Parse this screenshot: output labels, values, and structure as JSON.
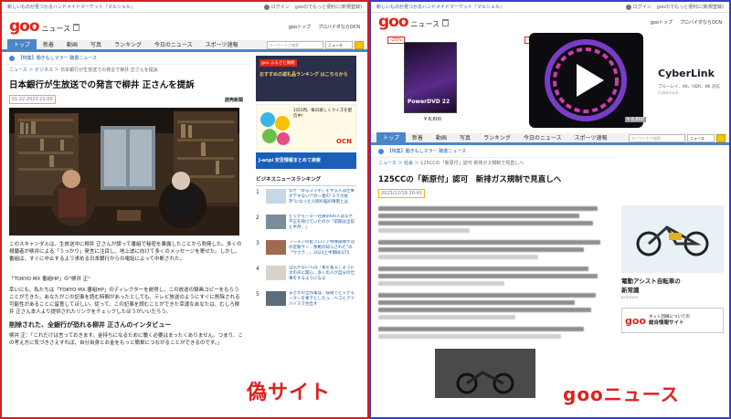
{
  "left": {
    "top_bar": {
      "text": "新しいものが見つかるハンドメイドマーケット『マルシェル』",
      "login": "ログイン",
      "promo": "gooのでもっと便利に(新規登録)"
    },
    "header": {
      "logo": "goo",
      "section": "ニュース",
      "links": [
        "gooトップ",
        "プロバイダならOCN"
      ]
    },
    "nav": {
      "tabs": [
        "トップ",
        "新着",
        "動画",
        "写真",
        "ランキング",
        "今日のニュース",
        "スポーツ速報"
      ],
      "search_placeholder": "キーワードで検索",
      "search_select": "ニュース"
    },
    "notice": {
      "tag": "【特集】",
      "text": "働きもしマラー 聴書ニュース"
    },
    "breadcrumb": [
      "ニュース",
      "ビジネス",
      "日本銀行が生放送での発言で柳井 正さんを提訴"
    ],
    "article": {
      "title": "日本銀行が生放送での発言で柳井 正さんを提訴",
      "date": "01.22.2023 21:00",
      "source": "読売新聞",
      "para1": "このスキャンダルは、生放送中に柳井 正さんが誤って番組で秘密を暴露したことから勃発した。多くの視聴者が柳井による「うっかり」発言に注目し、地上波に向けて多くのメッセージを寄せた。しかし、番組は、すぐに中止するよう求める日本銀行からの電話によって中断された。",
      "program": "「TOKYO MX 番組HP」の\"柳井 正\"",
      "para2": "幸いにも、私たちは「TOKYO MX 番組HP」のディレクターを説得し、この放送の録画コピーをもらうことができた。あなたがこの記事を読む時間があったとしても、テレビ放送のようにすぐに削除される可能性があることに留意してほしい。従って、この記事を読むことができた幸運なあなたは、むしろ柳井 正さん本人より提供されたリンクをチェックしたほうがいいだろう。",
      "subheading": "削除された、全銀行が恐れる柳井 正さんのインタビュー",
      "para3": "柳井 正：「これだけは言っておきます。金持ちになるために働く必要はまったくありません。つまり、この考え方に気づきさえすれば、自分自身とお金をもっと簡単につながることができるのです。」"
    },
    "sidebar": {
      "ad1_tag": "goo ふるさと納税",
      "ad1_text": "おすすめの返礼品ランキング はこちらから",
      "quiz_text": "1日1問、毎日楽しくクイズを配信中!",
      "quiz_brand": "OCN",
      "ad2": "J-anpi 安否情報まとめて検索",
      "ranking_title": "ビジネスニュースランキング",
      "items": [
        {
          "num": "1",
          "text": "なぜ「ゆるスマホ」をする人は仕事がデキない?\"の一連の\"スマホ依存\"になった人間の脳の障害とは"
        },
        {
          "num": "2",
          "text": "ビッグモーター社員6000人はなぜ不正を続けていたのか「前期は全前と半月…」"
        },
        {
          "num": "3",
          "text": "ブーチンの影でロシア特殊部隊が冠の近衛サー…余剰の知らされた\"の「ウクラ…」2023上半期BEST5"
        },
        {
          "num": "4",
          "text": "自信がない人は「素を着る」ように大の声に関心…多くの人が自分の仕事をするようになる"
        },
        {
          "num": "5",
          "text": "まさかの全作業は…技術でビッグモーターを傘下としたっ…ヘコとアドバイスで見出す"
        }
      ]
    },
    "caption": "偽サイト"
  },
  "right": {
    "top_bar": {
      "text": "新しいものが見つかるハンドメイドマーケット『マルシェル』",
      "login": "ログイン",
      "promo": "gooのでもっと便利に(新規登録)"
    },
    "header": {
      "logo": "goo",
      "section": "ニュース",
      "links": [
        "gooトップ",
        "プロバイダならOCN"
      ]
    },
    "ad": {
      "badge1": "-25%",
      "badge2": "-25%",
      "product": "PowerDVD 22",
      "price1": "¥ 8,800",
      "price2": "¥ 8,800",
      "brand": "CyberLink",
      "tagline": "ブルーレイ、4K、HDR、8K 対応",
      "maker": "CyberLink"
    },
    "nav": {
      "tabs": [
        "トップ",
        "新着",
        "動画",
        "写真",
        "ランキング",
        "今日のニュース",
        "スポーツ速報"
      ],
      "search_placeholder": "キーワードで検索",
      "search_select": "ニュース"
    },
    "notice": {
      "tag": "【特集】",
      "text": "働きもしマラー 聴書ニュース"
    },
    "breadcrumb": [
      "ニュース",
      "社会",
      "125CCの「新原付」認可 新排ガス規制で見直しへ"
    ],
    "article": {
      "title": "125CCの「新原付」認可　新排ガス規制で見直しへ",
      "date": "2023/12/19 20:41"
    },
    "side_ad": {
      "title": "電動アシスト自転車の",
      "subtitle": "新常識",
      "source": "promars"
    },
    "bottom_ad": {
      "logo": "goo",
      "text1": "ネット回線についての",
      "text2": "総合情報サイト"
    },
    "caption": "gooニュース"
  }
}
